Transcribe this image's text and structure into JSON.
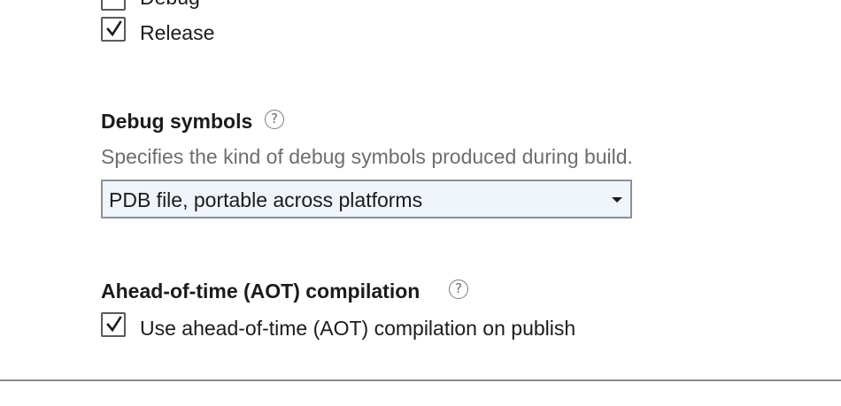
{
  "build_configurations": {
    "debug_label": "Debug",
    "debug_checked": false,
    "release_label": "Release",
    "release_checked": true
  },
  "debug_symbols": {
    "heading": "Debug symbols",
    "help_icon": "question-circle-icon",
    "description": "Specifies the kind of debug symbols produced during build.",
    "selected_value": "PDB file, portable across platforms"
  },
  "aot": {
    "heading": "Ahead-of-time (AOT) compilation",
    "help_icon": "question-circle-icon",
    "checkbox_label": "Use ahead-of-time (AOT) compilation on publish",
    "checked": true
  },
  "colors": {
    "select_background": "#f0f4fb",
    "select_border": "#8a8f99",
    "description_text": "#6d6d6d"
  }
}
